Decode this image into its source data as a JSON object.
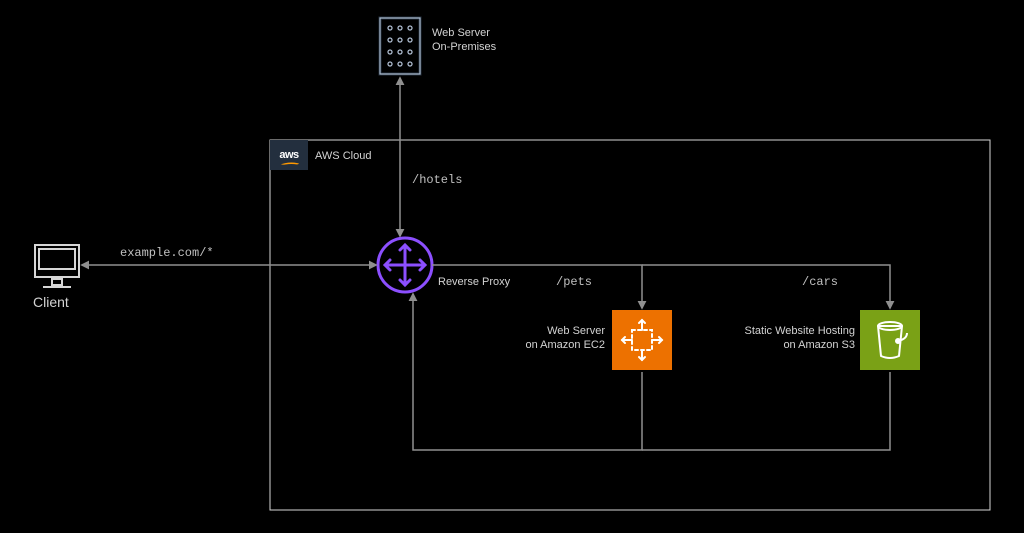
{
  "diagram": {
    "client_label": "Client",
    "client_path": "example.com/*",
    "cloud_label": "AWS Cloud",
    "onprem_label": "Web Server\nOn-Premises",
    "proxy_label": "Reverse Proxy",
    "route_hotels": "/hotels",
    "route_pets": "/pets",
    "route_cars": "/cars",
    "ec2_label": "Web Server\non Amazon EC2",
    "s3_label": "Static Website Hosting\non Amazon S3"
  },
  "colors": {
    "line": "#8f8f8f",
    "stroke": "#d6d6d6",
    "proxy": "#8c4fff",
    "ec2": "#ed7100",
    "s3": "#7aa116",
    "onprem": "#232f3e"
  }
}
